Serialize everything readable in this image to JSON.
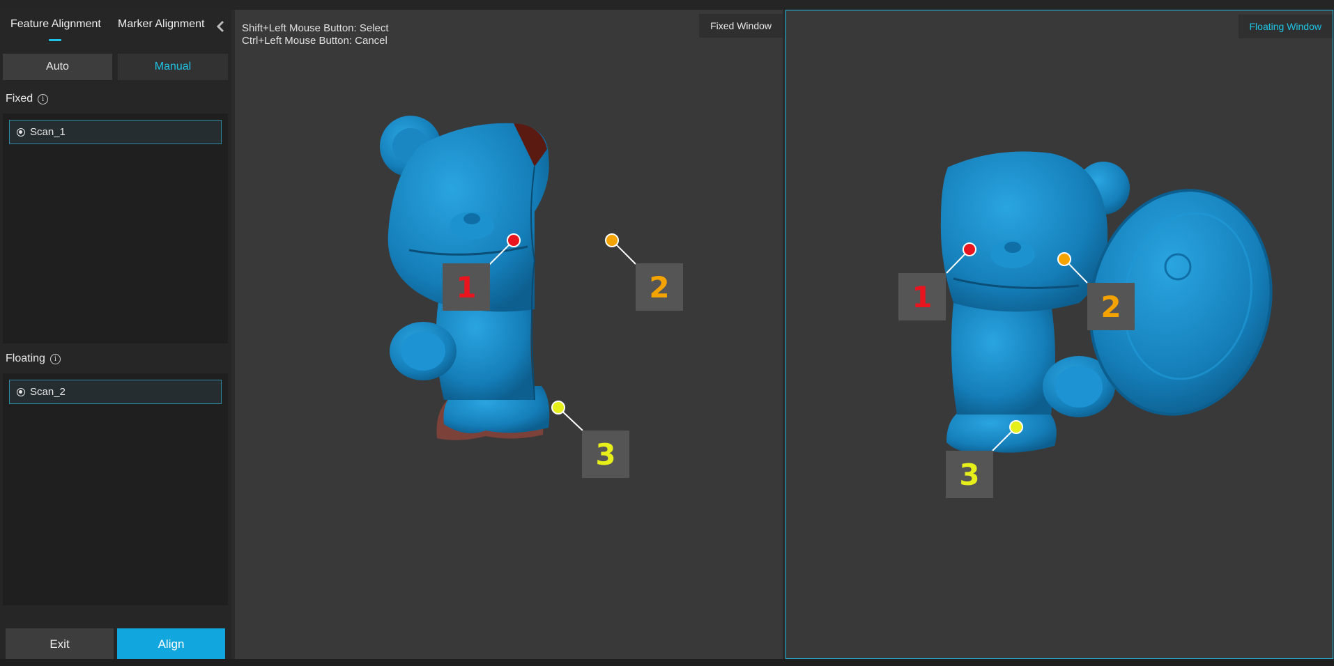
{
  "sidebar": {
    "tabs": [
      {
        "label": "Feature Alignment",
        "active": true
      },
      {
        "label": "Marker Alignment",
        "active": false
      }
    ],
    "modes": {
      "auto": "Auto",
      "manual": "Manual",
      "selected": "Manual"
    },
    "fixed": {
      "label": "Fixed",
      "info_icon": "info-icon",
      "scan": "Scan_1"
    },
    "floating": {
      "label": "Floating",
      "info_icon": "info-icon",
      "scan": "Scan_2"
    },
    "buttons": {
      "exit": "Exit",
      "align": "Align"
    }
  },
  "fixed_window": {
    "title": "Fixed Window",
    "hint_select": "Shift+Left Mouse Button: Select",
    "hint_cancel": "Ctrl+Left Mouse Button: Cancel",
    "points": [
      {
        "label": "1",
        "color": "#e8141e"
      },
      {
        "label": "2",
        "color": "#f5a300"
      },
      {
        "label": "3",
        "color": "#e6ef1a"
      }
    ]
  },
  "floating_window": {
    "title": "Floating Window",
    "points": [
      {
        "label": "1",
        "color": "#e8141e"
      },
      {
        "label": "2",
        "color": "#f5a300"
      },
      {
        "label": "3",
        "color": "#e6ef1a"
      }
    ]
  },
  "colors": {
    "accent": "#1ec3e6",
    "align_button": "#11a6dd",
    "model": "#1a8cc8"
  }
}
